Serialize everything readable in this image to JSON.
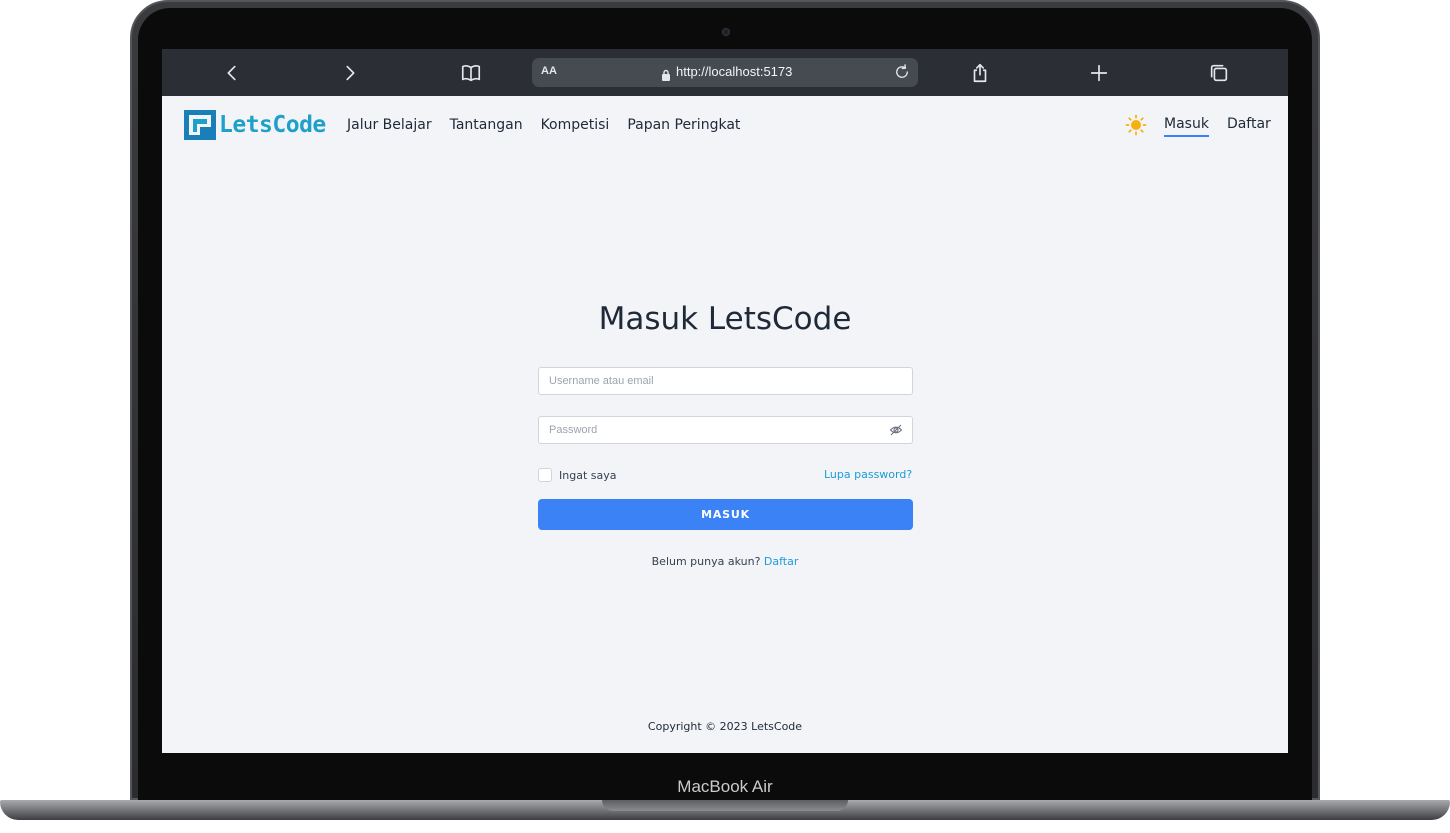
{
  "device": {
    "model_label": "MacBook Air"
  },
  "browser": {
    "address_prefix": "AA",
    "url": "http://localhost:5173",
    "icons": [
      "chevron-left-icon",
      "chevron-right-icon",
      "book-icon",
      "lock-icon",
      "reload-icon",
      "share-icon",
      "plus-icon",
      "tabs-icon"
    ]
  },
  "nav": {
    "logo_text": "LetsCode",
    "links": [
      "Jalur Belajar",
      "Tantangan",
      "Kompetisi",
      "Papan Peringkat"
    ],
    "theme_icon": "sun-icon",
    "login_label": "Masuk",
    "register_label": "Daftar"
  },
  "login": {
    "title": "Masuk LetsCode",
    "username_placeholder": "Username atau email",
    "password_placeholder": "Password",
    "remember_label": "Ingat saya",
    "forgot_label": "Lupa password?",
    "submit_label": "MASUK",
    "no_account_text": "Belum punya akun?",
    "register_link": "Daftar"
  },
  "footer": {
    "copyright": "Copyright © 2023 LetsCode"
  },
  "colors": {
    "accent": "#3b82f6",
    "link": "#1d9bd8",
    "logo": "#1da0c9",
    "background": "#f2f4f8",
    "toolbar": "#2b2f35"
  }
}
